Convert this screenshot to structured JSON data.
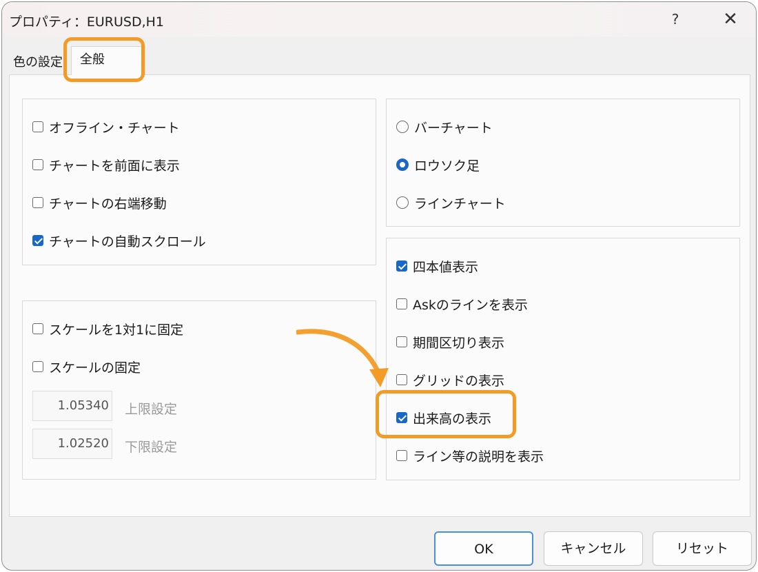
{
  "window": {
    "title": "プロパティ：EURUSD,H1",
    "help_glyph": "?",
    "close_glyph": "✕"
  },
  "tabs": [
    {
      "label": "色の設定",
      "visible_label": "色の設定",
      "selected": false
    },
    {
      "label": "全般",
      "selected": true
    }
  ],
  "left_group_top": {
    "options": [
      {
        "label": "オフライン・チャート",
        "checked": false
      },
      {
        "label": "チャートを前面に表示",
        "checked": false
      },
      {
        "label": "チャートの右端移動",
        "checked": false
      },
      {
        "label": "チャートの自動スクロール",
        "checked": true
      }
    ]
  },
  "left_group_bottom": {
    "options": [
      {
        "label": "スケールを1対1に固定",
        "checked": false
      },
      {
        "label": "スケールの固定",
        "checked": false
      }
    ],
    "upper_value": "1.05340",
    "upper_label": "上限設定",
    "lower_value": "1.02520",
    "lower_label": "下限設定"
  },
  "chart_type": {
    "options": [
      {
        "label": "バーチャート",
        "selected": false
      },
      {
        "label": "ロウソク足",
        "selected": true
      },
      {
        "label": "ラインチャート",
        "selected": false
      }
    ]
  },
  "right_group_bottom": {
    "options": [
      {
        "label": "四本値表示",
        "checked": true
      },
      {
        "label": "Askのラインを表示",
        "checked": false
      },
      {
        "label": "期間区切り表示",
        "checked": false
      },
      {
        "label": "グリッドの表示",
        "checked": false
      },
      {
        "label": "出来高の表示",
        "checked": true
      },
      {
        "label": "ライン等の説明を表示",
        "checked": false
      }
    ]
  },
  "buttons": {
    "ok": "OK",
    "cancel": "キャンセル",
    "reset": "リセット"
  },
  "colors": {
    "highlight": "#f29b26",
    "accent": "#1a68c6"
  }
}
